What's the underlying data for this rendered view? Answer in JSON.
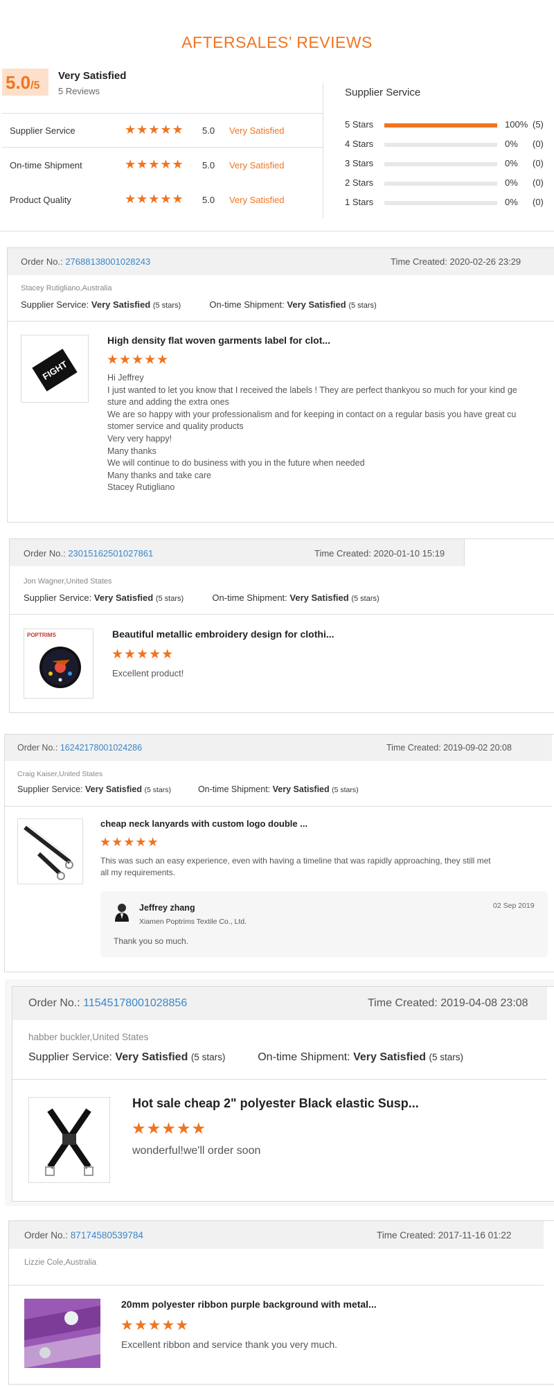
{
  "title": "AFTERSALES’ REVIEWS",
  "summary": {
    "score": "5.0",
    "score_denominator": "/5",
    "overall_label": "Very Satisfied",
    "review_count": "5 Reviews",
    "ratings": [
      {
        "label": "Supplier Service",
        "stars": "★★★★★",
        "value": "5.0",
        "word": "Very Satisfied"
      },
      {
        "label": "On-time Shipment",
        "stars": "★★★★★",
        "value": "5.0",
        "word": "Very Satisfied"
      },
      {
        "label": "Product Quality",
        "stars": "★★★★★",
        "value": "5.0",
        "word": "Very Satisfied"
      }
    ]
  },
  "distribution": {
    "title": "Supplier Service",
    "rows": [
      {
        "label": "5 Stars",
        "percent": "100%",
        "count": "(5)",
        "fill": 1.0
      },
      {
        "label": "4 Stars",
        "percent": "0%",
        "count": "(0)",
        "fill": 0
      },
      {
        "label": "3 Stars",
        "percent": "0%",
        "count": "(0)",
        "fill": 0
      },
      {
        "label": "2 Stars",
        "percent": "0%",
        "count": "(0)",
        "fill": 0
      },
      {
        "label": "1 Stars",
        "percent": "0%",
        "count": "(0)",
        "fill": 0
      }
    ]
  },
  "reviews": [
    {
      "order_label": "Order No.:",
      "order_no": "27688138001028243",
      "time_label": "Time Created:",
      "time": "2020-02-26 23:29",
      "reviewer": "Stacey Rutigliano,Australia",
      "supplier_label": "Supplier Service:",
      "supplier_value": "Very Satisfied",
      "supplier_stars": "(5 stars)",
      "shipment_label": "On-time Shipment:",
      "shipment_value": "Very Satisfied",
      "shipment_stars": "(5 stars)",
      "product_name": "High density flat woven garments label for clot...",
      "stars": "★★★★★",
      "text_lines": [
        "Hi Jeffrey",
        "I just wanted to let you know that I received the labels ! They are perfect thankyou so much for your kind ge",
        "sture and adding the extra ones",
        "We are so happy with your professionalism and for keeping in contact on a regular basis you have great cu",
        "stomer service and quality products",
        "Very very happy!",
        "Many thanks",
        "We will continue to do business with you in the future when needed",
        "Many thanks and take care",
        "Stacey Rutigliano"
      ],
      "image_text": "FIGHT"
    },
    {
      "order_label": "Order No.:",
      "order_no": "23015162501027861",
      "time_label": "Time Created:",
      "time": "2020-01-10 15:19",
      "reviewer": "Jon Wagner,United States",
      "supplier_label": "Supplier Service:",
      "supplier_value": "Very Satisfied",
      "supplier_stars": "(5 stars)",
      "shipment_label": "On-time Shipment:",
      "shipment_value": "Very Satisfied",
      "shipment_stars": "(5 stars)",
      "product_name": "Beautiful metallic embroidery design for clothi...",
      "stars": "★★★★★",
      "text": "Excellent product!",
      "image_text": "POPTRIMS"
    },
    {
      "order_label": "Order No.:",
      "order_no": "16242178001024286",
      "time_label": "Time Created:",
      "time": "2019-09-02 20:08",
      "reviewer": "Craig Kaiser,United States",
      "supplier_label": "Supplier Service:",
      "supplier_value": "Very Satisfied",
      "supplier_stars": "(5 stars)",
      "shipment_label": "On-time Shipment:",
      "shipment_value": "Very Satisfied",
      "shipment_stars": "(5 stars)",
      "product_name": "cheap neck lanyards with custom logo double ...",
      "stars": "★★★★★",
      "text_lines": [
        "This was such an easy experience, even with having a timeline that was rapidly approaching, they still met",
        "all my requirements."
      ],
      "reply": {
        "name": "Jeffrey zhang",
        "company": "Xiamen Poptrims Textile Co., Ltd.",
        "date": "02 Sep 2019",
        "text": "Thank you so much."
      }
    },
    {
      "order_label": "Order No.:",
      "order_no": "11545178001028856",
      "time_label": "Time Created:",
      "time": "2019-04-08 23:08",
      "reviewer": "habber buckler,United States",
      "supplier_label": "Supplier Service:",
      "supplier_value": "Very Satisfied",
      "supplier_stars": "(5 stars)",
      "shipment_label": "On-time Shipment:",
      "shipment_value": "Very Satisfied",
      "shipment_stars": "(5 stars)",
      "product_name": "Hot sale cheap 2\" polyester Black elastic Susp...",
      "stars": "★★★★★",
      "text": "wonderful!we'll order soon"
    },
    {
      "order_label": "Order No.:",
      "order_no": "87174580539784",
      "time_label": "Time Created:",
      "time": "2017-11-16 01:22",
      "reviewer": "Lizzie Cole,Australia",
      "product_name": "20mm polyester ribbon purple background with metal...",
      "stars": "★★★★★",
      "text": "Excellent ribbon and service thank you very much."
    }
  ]
}
